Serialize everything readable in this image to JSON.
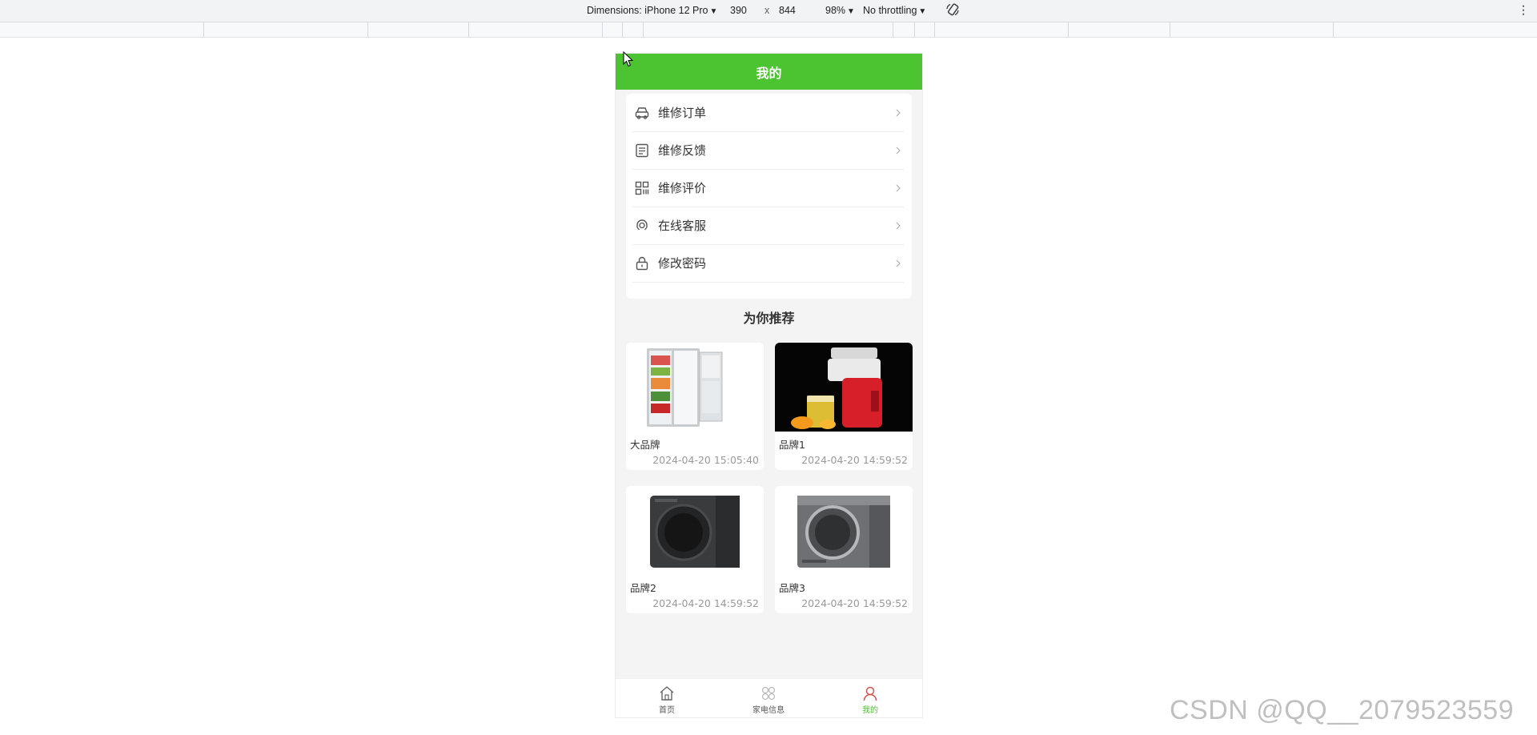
{
  "devtools": {
    "dimensions_label": "Dimensions: iPhone 12 Pro",
    "width": "390",
    "times": "x",
    "height": "844",
    "zoom": "98%",
    "throttling": "No throttling"
  },
  "header": {
    "title": "我的"
  },
  "menu": [
    {
      "label": "维修订单",
      "icon": "car-icon"
    },
    {
      "label": "维修反馈",
      "icon": "list-icon"
    },
    {
      "label": "维修评价",
      "icon": "grid-icon"
    },
    {
      "label": "在线客服",
      "icon": "headset-icon"
    },
    {
      "label": "修改密码",
      "icon": "lock-icon"
    }
  ],
  "recommend": {
    "title": "为你推荐",
    "items": [
      {
        "name": "大品牌",
        "time": "2024-04-20 15:05:40"
      },
      {
        "name": "品牌1",
        "time": "2024-04-20 14:59:52"
      },
      {
        "name": "品牌2",
        "time": "2024-04-20 14:59:52"
      },
      {
        "name": "品牌3",
        "time": "2024-04-20 14:59:52"
      }
    ]
  },
  "tabbar": [
    {
      "label": "首页",
      "icon": "home-icon"
    },
    {
      "label": "家电信息",
      "icon": "appliance-icon"
    },
    {
      "label": "我的",
      "icon": "user-icon"
    }
  ],
  "colors": {
    "brand": "#4cc331",
    "background": "#f4f4f4"
  },
  "watermark": "CSDN @QQ__2079523559"
}
